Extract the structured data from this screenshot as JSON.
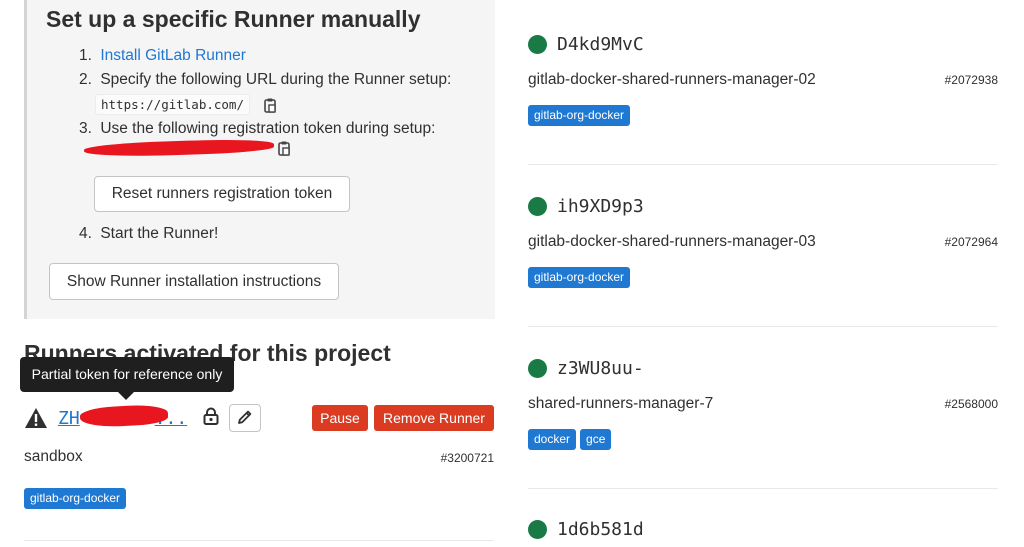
{
  "setup": {
    "title": "Set up a specific Runner manually",
    "step1_num": "1.",
    "step1_link": "Install GitLab Runner",
    "step2_num": "2.",
    "step2_text": "Specify the following URL during the Runner setup:",
    "url": "https://gitlab.com/",
    "step3_num": "3.",
    "step3_text": "Use the following registration token during setup:",
    "reset_button": "Reset runners registration token",
    "step4_num": "4.",
    "step4_text": "Start the Runner!",
    "install_button": "Show Runner installation instructions"
  },
  "activated": {
    "title": "Runners activated for this project",
    "tooltip": "Partial token for reference only",
    "runner": {
      "token_visible": "ZH",
      "token_suffix": "...",
      "pause_button": "Pause",
      "remove_button": "Remove Runner",
      "description": "sandbox",
      "id": "#3200721",
      "tags": [
        "gitlab-org-docker"
      ]
    }
  },
  "shared_runners": [
    {
      "name": "D4kd9MvC",
      "description": "gitlab-docker-shared-runners-manager-02",
      "id": "#2072938",
      "tags": [
        "gitlab-org-docker"
      ]
    },
    {
      "name": "ih9XD9p3",
      "description": "gitlab-docker-shared-runners-manager-03",
      "id": "#2072964",
      "tags": [
        "gitlab-org-docker"
      ]
    },
    {
      "name": "z3WU8uu-",
      "description": "shared-runners-manager-7",
      "id": "#2568000",
      "tags": [
        "docker",
        "gce"
      ]
    },
    {
      "name": "1d6b581d",
      "description": "",
      "id": "",
      "tags": []
    }
  ],
  "colors": {
    "link": "#1f78d1",
    "badge": "#1f78d1",
    "danger": "#db3b21",
    "online": "#1a7a45",
    "redaction": "#e8171f"
  },
  "icons": {
    "copy": "clipboard-icon",
    "warning": "warning-triangle-icon",
    "lock": "lock-icon",
    "edit": "pencil-icon",
    "status": "status-online-dot-icon"
  }
}
